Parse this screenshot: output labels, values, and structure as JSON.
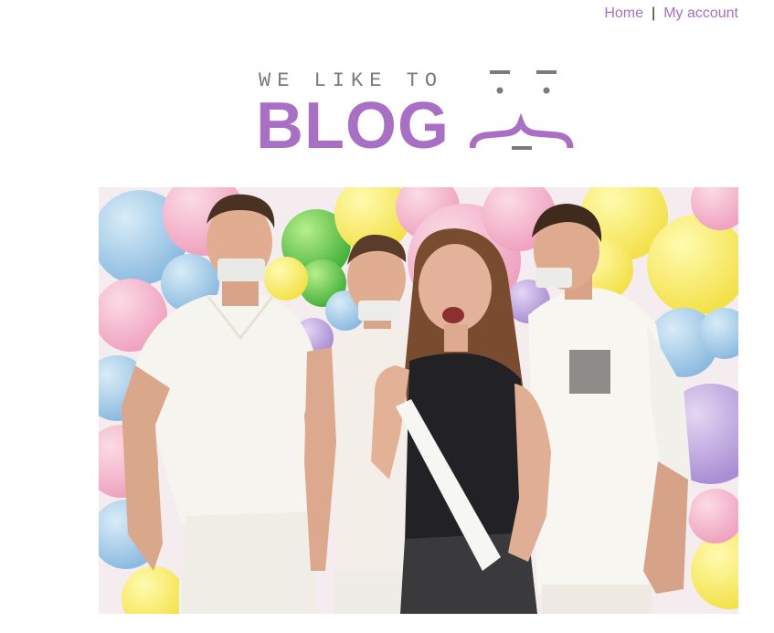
{
  "nav": {
    "home": "Home",
    "separator": "|",
    "account": "My account"
  },
  "logo": {
    "tagline": "WE LIKE TO",
    "word": "BLOG"
  },
  "colors": {
    "accent": "#a86fc4",
    "tagline": "#7a7a7a"
  }
}
